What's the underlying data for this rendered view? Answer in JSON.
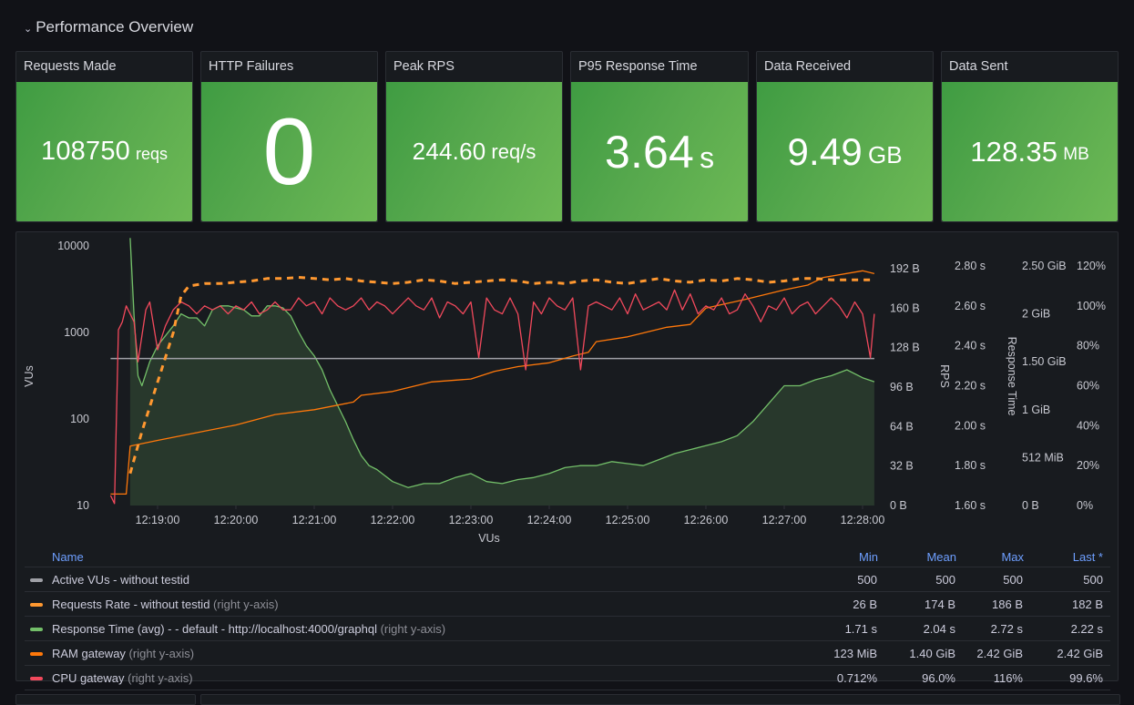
{
  "row": {
    "title": "Performance Overview",
    "collapse_icon": "chevron-down-icon"
  },
  "stats": [
    {
      "title": "Requests Made",
      "value": "108750",
      "unit": "reqs",
      "size": "small"
    },
    {
      "title": "HTTP Failures",
      "value": "0",
      "unit": "",
      "size": "huge"
    },
    {
      "title": "Peak RPS",
      "value": "244.60",
      "unit": "req/s",
      "size": "small"
    },
    {
      "title": "P95 Response Time",
      "value": "3.64",
      "unit": "s",
      "size": "large"
    },
    {
      "title": "Data Received",
      "value": "9.49",
      "unit": "GB",
      "size": "large"
    },
    {
      "title": "Data Sent",
      "value": "128.35",
      "unit": "MB",
      "size": "small"
    }
  ],
  "colors": {
    "stat_green": "#56a84d",
    "vus": "#9fa0a6",
    "rps": "#ff9830",
    "response_time": "#73bf69",
    "ram": "#ff780a",
    "cpu": "#f2495c",
    "legend_header": "#6e9fff"
  },
  "chart_data": {
    "type": "line",
    "title": "",
    "xlabel": "VUs",
    "x_ticks": [
      "12:19:00",
      "12:20:00",
      "12:21:00",
      "12:22:00",
      "12:23:00",
      "12:24:00",
      "12:25:00",
      "12:26:00",
      "12:27:00",
      "12:28:00"
    ],
    "x_range_minutes": [
      -0.7,
      9.15
    ],
    "y_left": {
      "label": "VUs",
      "scale": "log",
      "range": [
        10,
        10000
      ],
      "ticks": [
        "10",
        "100",
        "1000",
        "10000"
      ]
    },
    "y_right_axes": [
      {
        "label": "",
        "unit": "bytes",
        "range": [
          0,
          192
        ],
        "ticks": [
          "0 B",
          "32 B",
          "64 B",
          "96 B",
          "128 B",
          "160 B",
          "192 B"
        ]
      },
      {
        "label": "RPS",
        "unit": "s",
        "range": [
          1.6,
          2.8
        ],
        "ticks": [
          "1.60 s",
          "1.80 s",
          "2.00 s",
          "2.20 s",
          "2.40 s",
          "2.60 s",
          "2.80 s"
        ]
      },
      {
        "label": "Response Time",
        "unit": "GiB",
        "range": [
          0,
          2.5
        ],
        "ticks": [
          "0 B",
          "512 MiB",
          "1 GiB",
          "1.50 GiB",
          "2 GiB",
          "2.50 GiB"
        ]
      },
      {
        "label": "",
        "unit": "%",
        "range": [
          0,
          120
        ],
        "ticks": [
          "0%",
          "20%",
          "40%",
          "60%",
          "80%",
          "100%",
          "120%"
        ]
      }
    ],
    "series": [
      {
        "name": "Active VUs - without testid",
        "axis": "left",
        "style": "solid",
        "x": [
          -0.6,
          9.15
        ],
        "values": [
          500,
          500
        ]
      },
      {
        "name": "Requests Rate - without testid",
        "axis": "bytes",
        "style": "dashed",
        "x": [
          -0.35,
          -0.2,
          0,
          0.2,
          0.3,
          0.4,
          0.6,
          0.8,
          1.0,
          1.2,
          1.4,
          1.6,
          1.8,
          2.0,
          2.2,
          2.4,
          2.6,
          2.8,
          3.0,
          3.2,
          3.4,
          3.6,
          3.8,
          4.0,
          4.2,
          4.4,
          4.6,
          4.8,
          5.0,
          5.2,
          5.4,
          5.6,
          5.8,
          6.0,
          6.2,
          6.4,
          6.6,
          6.8,
          7.0,
          7.2,
          7.4,
          7.6,
          7.8,
          8.0,
          8.2,
          8.4,
          8.6,
          8.8,
          9.0,
          9.15
        ],
        "values": [
          26,
          60,
          100,
          140,
          170,
          178,
          180,
          180,
          181,
          182,
          184,
          184,
          185,
          184,
          183,
          184,
          182,
          181,
          180,
          181,
          183,
          182,
          180,
          181,
          182,
          183,
          182,
          180,
          181,
          180,
          182,
          183,
          181,
          180,
          182,
          184,
          182,
          181,
          183,
          182,
          184,
          183,
          181,
          182,
          184,
          184,
          183,
          183,
          183,
          183
        ]
      },
      {
        "name": "Response Time (avg) - - default - http://localhost:4000/graphql",
        "axis": "seconds",
        "style": "area",
        "x": [
          -0.35,
          -0.3,
          -0.25,
          -0.2,
          -0.1,
          0,
          0.1,
          0.2,
          0.3,
          0.4,
          0.5,
          0.6,
          0.7,
          0.8,
          0.9,
          1.0,
          1.1,
          1.2,
          1.3,
          1.4,
          1.5,
          1.6,
          1.7,
          1.8,
          1.9,
          2.0,
          2.1,
          2.2,
          2.3,
          2.4,
          2.5,
          2.6,
          2.7,
          2.8,
          2.9,
          3.0,
          3.2,
          3.4,
          3.6,
          3.8,
          4.0,
          4.2,
          4.4,
          4.6,
          4.8,
          5.0,
          5.2,
          5.4,
          5.6,
          5.8,
          6.0,
          6.2,
          6.4,
          6.6,
          6.8,
          7.0,
          7.2,
          7.4,
          7.6,
          7.8,
          8.0,
          8.2,
          8.4,
          8.6,
          8.8,
          9.0,
          9.15
        ],
        "values": [
          2.94,
          2.55,
          2.25,
          2.2,
          2.32,
          2.4,
          2.45,
          2.5,
          2.56,
          2.54,
          2.54,
          2.5,
          2.58,
          2.6,
          2.6,
          2.59,
          2.58,
          2.55,
          2.55,
          2.6,
          2.6,
          2.59,
          2.55,
          2.47,
          2.4,
          2.35,
          2.28,
          2.18,
          2.1,
          2.02,
          1.93,
          1.85,
          1.8,
          1.78,
          1.75,
          1.72,
          1.69,
          1.71,
          1.71,
          1.74,
          1.76,
          1.72,
          1.71,
          1.73,
          1.74,
          1.76,
          1.79,
          1.8,
          1.8,
          1.82,
          1.81,
          1.8,
          1.83,
          1.86,
          1.88,
          1.9,
          1.92,
          1.95,
          2.02,
          2.11,
          2.2,
          2.2,
          2.23,
          2.25,
          2.28,
          2.24,
          2.22
        ]
      },
      {
        "name": "RAM gateway",
        "axis": "gib",
        "style": "solid",
        "x": [
          -0.6,
          -0.4,
          -0.35,
          0,
          0.5,
          1.0,
          1.5,
          2.0,
          2.5,
          2.6,
          3.0,
          3.5,
          4.0,
          4.3,
          4.6,
          5.0,
          5.3,
          5.5,
          5.6,
          6.0,
          6.5,
          6.8,
          7.0,
          7.5,
          8.0,
          8.3,
          8.5,
          9.0,
          9.15
        ],
        "values": [
          0.12,
          0.12,
          0.62,
          0.68,
          0.76,
          0.84,
          0.95,
          1.0,
          1.08,
          1.15,
          1.19,
          1.29,
          1.32,
          1.4,
          1.45,
          1.49,
          1.56,
          1.6,
          1.71,
          1.76,
          1.86,
          1.89,
          2.06,
          2.15,
          2.25,
          2.3,
          2.38,
          2.45,
          2.42
        ]
      },
      {
        "name": "CPU gateway",
        "axis": "percent",
        "style": "solid",
        "x": [
          -0.6,
          -0.55,
          -0.5,
          -0.45,
          -0.4,
          -0.3,
          -0.25,
          -0.15,
          -0.1,
          0.0,
          0.1,
          0.2,
          0.3,
          0.4,
          0.5,
          0.6,
          0.7,
          0.8,
          0.9,
          1.0,
          1.1,
          1.2,
          1.3,
          1.4,
          1.5,
          1.6,
          1.7,
          1.8,
          1.9,
          2.0,
          2.1,
          2.2,
          2.3,
          2.4,
          2.5,
          2.6,
          2.7,
          2.8,
          2.9,
          3.0,
          3.1,
          3.2,
          3.3,
          3.4,
          3.5,
          3.6,
          3.7,
          3.8,
          3.9,
          4.0,
          4.1,
          4.2,
          4.3,
          4.4,
          4.5,
          4.6,
          4.7,
          4.8,
          4.9,
          5.0,
          5.1,
          5.2,
          5.3,
          5.4,
          5.5,
          5.6,
          5.7,
          5.8,
          5.9,
          6.0,
          6.1,
          6.2,
          6.3,
          6.4,
          6.5,
          6.6,
          6.7,
          6.8,
          6.9,
          7.0,
          7.1,
          7.2,
          7.3,
          7.4,
          7.5,
          7.6,
          7.7,
          7.8,
          7.9,
          8.0,
          8.1,
          8.2,
          8.3,
          8.4,
          8.5,
          8.6,
          8.7,
          8.8,
          8.9,
          9.0,
          9.1,
          9.15
        ],
        "values": [
          5,
          1,
          88,
          92,
          100,
          92,
          72,
          98,
          102,
          78,
          90,
          98,
          102,
          100,
          96,
          100,
          98,
          100,
          96,
          100,
          98,
          102,
          96,
          98,
          102,
          98,
          98,
          104,
          100,
          102,
          96,
          104,
          100,
          98,
          100,
          104,
          98,
          102,
          100,
          96,
          100,
          104,
          100,
          98,
          104,
          94,
          102,
          100,
          96,
          102,
          74,
          104,
          98,
          96,
          104,
          96,
          68,
          102,
          96,
          104,
          100,
          98,
          104,
          68,
          100,
          102,
          100,
          98,
          104,
          96,
          106,
          98,
          100,
          102,
          98,
          108,
          98,
          106,
          96,
          100,
          98,
          104,
          96,
          98,
          106,
          100,
          92,
          100,
          98,
          104,
          96,
          100,
          102,
          96,
          100,
          104,
          100,
          94,
          102,
          96,
          74,
          96
        ]
      }
    ]
  },
  "legend": {
    "headers": {
      "name": "Name",
      "min": "Min",
      "mean": "Mean",
      "max": "Max",
      "last": "Last *"
    },
    "rows": [
      {
        "name": "Active VUs - without testid",
        "hint": "",
        "color": "#9fa0a6",
        "min": "500",
        "mean": "500",
        "max": "500",
        "last": "500"
      },
      {
        "name": "Requests Rate - without testid",
        "hint": "(right y-axis)",
        "color": "#ff9830",
        "min": "26 B",
        "mean": "174 B",
        "max": "186 B",
        "last": "182 B"
      },
      {
        "name": "Response Time (avg) - - default - http://localhost:4000/graphql",
        "hint": "(right y-axis)",
        "color": "#73bf69",
        "min": "1.71 s",
        "mean": "2.04 s",
        "max": "2.72 s",
        "last": "2.22 s"
      },
      {
        "name": "RAM gateway",
        "hint": "(right y-axis)",
        "color": "#ff780a",
        "min": "123 MiB",
        "mean": "1.40 GiB",
        "max": "2.42 GiB",
        "last": "2.42 GiB"
      },
      {
        "name": "CPU gateway",
        "hint": "(right y-axis)",
        "color": "#f2495c",
        "min": "0.712%",
        "mean": "96.0%",
        "max": "116%",
        "last": "99.6%"
      }
    ]
  }
}
